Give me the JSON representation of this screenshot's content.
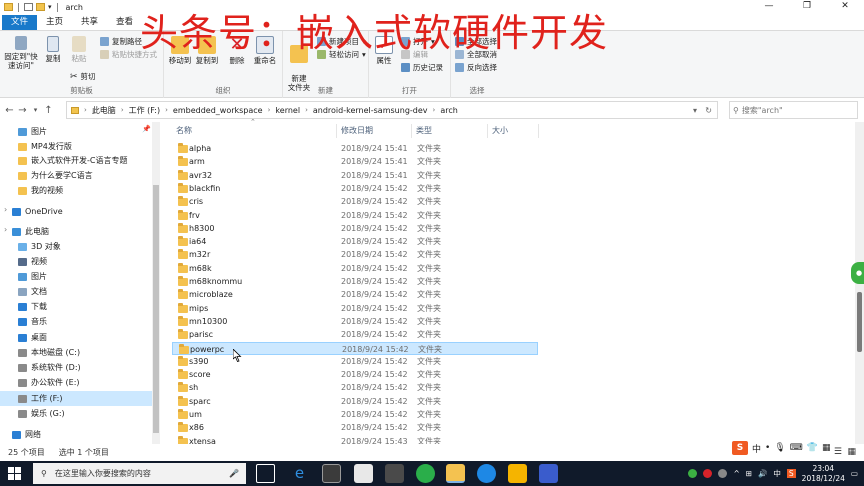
{
  "window": {
    "title": "arch",
    "min_glyph": "—",
    "max_glyph": "❐",
    "close_glyph": "✕"
  },
  "ribbon_tabs": [
    "文件",
    "主页",
    "共享",
    "查看"
  ],
  "watermark": "头条号：嵌入式软硬件开发",
  "ribbon": {
    "clipboard": {
      "label": "剪贴板",
      "pin": "固定到\"快速访问\"",
      "copy": "复制",
      "paste": "粘贴",
      "copy_path": "复制路径",
      "paste_shortcut": "粘贴快捷方式",
      "cut": "剪切"
    },
    "organize": {
      "label": "组织",
      "move_to": "移动到",
      "copy_to": "复制到",
      "delete": "删除",
      "rename": "重命名"
    },
    "new": {
      "label": "新建",
      "new_folder": "新建\n文件夹",
      "new_item": "新建项目",
      "easy_access": "轻松访问"
    },
    "open": {
      "label": "打开",
      "properties": "属性",
      "open": "打开",
      "edit": "编辑",
      "history": "历史记录"
    },
    "select": {
      "label": "选择",
      "select_all": "全部选择",
      "select_none": "全部取消",
      "invert": "反向选择"
    }
  },
  "address": {
    "crumbs": [
      "此电脑",
      "工作 (F:)",
      "embedded_workspace",
      "kernel",
      "android-kernel-samsung-dev",
      "arch"
    ],
    "search_placeholder": "搜索\"arch\""
  },
  "nav_pane": {
    "items": [
      {
        "label": "图片",
        "icon": "pictures-icon",
        "color": "#4f9ad8"
      },
      {
        "label": "MP4发行版",
        "icon": "folder-icon",
        "color": "#f4c250"
      },
      {
        "label": "嵌入式软件开发-C语言专题",
        "icon": "folder-icon",
        "color": "#f4c250"
      },
      {
        "label": "为什么要学C语言",
        "icon": "folder-icon",
        "color": "#f4c250"
      },
      {
        "label": "我的视频",
        "icon": "folder-icon",
        "color": "#f4c250"
      },
      {
        "label": "OneDrive",
        "icon": "cloud-icon",
        "color": "#2a7fd4"
      },
      {
        "label": "此电脑",
        "icon": "computer-icon",
        "color": "#3a8fd8"
      },
      {
        "label": "3D 对象",
        "icon": "cube-icon",
        "color": "#6ab0e8"
      },
      {
        "label": "视频",
        "icon": "video-icon",
        "color": "#556b8a"
      },
      {
        "label": "图片",
        "icon": "pictures-icon",
        "color": "#4f9ad8"
      },
      {
        "label": "文档",
        "icon": "document-icon",
        "color": "#8aa4c0"
      },
      {
        "label": "下载",
        "icon": "download-icon",
        "color": "#2a7fd4"
      },
      {
        "label": "音乐",
        "icon": "music-icon",
        "color": "#2a7fd4"
      },
      {
        "label": "桌面",
        "icon": "desktop-icon",
        "color": "#2a7fd4"
      },
      {
        "label": "本地磁盘 (C:)",
        "icon": "drive-icon",
        "color": "#8a8a8a"
      },
      {
        "label": "系统软件 (D:)",
        "icon": "drive-icon",
        "color": "#8a8a8a"
      },
      {
        "label": "办公软件 (E:)",
        "icon": "drive-icon",
        "color": "#8a8a8a"
      },
      {
        "label": "工作 (F:)",
        "icon": "drive-icon",
        "color": "#8a8a8a"
      },
      {
        "label": "娱乐 (G:)",
        "icon": "drive-icon",
        "color": "#8a8a8a"
      },
      {
        "label": "网络",
        "icon": "network-icon",
        "color": "#2a7fd4"
      }
    ]
  },
  "columns": {
    "name": "名称",
    "modified": "修改日期",
    "type": "类型",
    "size": "大小"
  },
  "files": [
    {
      "name": "alpha",
      "date": "2018/9/24 15:41",
      "type": "文件夹"
    },
    {
      "name": "arm",
      "date": "2018/9/24 15:41",
      "type": "文件夹"
    },
    {
      "name": "avr32",
      "date": "2018/9/24 15:41",
      "type": "文件夹"
    },
    {
      "name": "blackfin",
      "date": "2018/9/24 15:42",
      "type": "文件夹"
    },
    {
      "name": "cris",
      "date": "2018/9/24 15:42",
      "type": "文件夹"
    },
    {
      "name": "frv",
      "date": "2018/9/24 15:42",
      "type": "文件夹"
    },
    {
      "name": "h8300",
      "date": "2018/9/24 15:42",
      "type": "文件夹"
    },
    {
      "name": "ia64",
      "date": "2018/9/24 15:42",
      "type": "文件夹"
    },
    {
      "name": "m32r",
      "date": "2018/9/24 15:42",
      "type": "文件夹"
    },
    {
      "name": "m68k",
      "date": "2018/9/24 15:42",
      "type": "文件夹"
    },
    {
      "name": "m68knommu",
      "date": "2018/9/24 15:42",
      "type": "文件夹"
    },
    {
      "name": "microblaze",
      "date": "2018/9/24 15:42",
      "type": "文件夹"
    },
    {
      "name": "mips",
      "date": "2018/9/24 15:42",
      "type": "文件夹"
    },
    {
      "name": "mn10300",
      "date": "2018/9/24 15:42",
      "type": "文件夹"
    },
    {
      "name": "parisc",
      "date": "2018/9/24 15:42",
      "type": "文件夹"
    },
    {
      "name": "powerpc",
      "date": "2018/9/24 15:42",
      "type": "文件夹"
    },
    {
      "name": "s390",
      "date": "2018/9/24 15:42",
      "type": "文件夹"
    },
    {
      "name": "score",
      "date": "2018/9/24 15:42",
      "type": "文件夹"
    },
    {
      "name": "sh",
      "date": "2018/9/24 15:42",
      "type": "文件夹"
    },
    {
      "name": "sparc",
      "date": "2018/9/24 15:42",
      "type": "文件夹"
    },
    {
      "name": "um",
      "date": "2018/9/24 15:42",
      "type": "文件夹"
    },
    {
      "name": "x86",
      "date": "2018/9/24 15:42",
      "type": "文件夹"
    },
    {
      "name": "xtensa",
      "date": "2018/9/24 15:43",
      "type": "文件夹"
    }
  ],
  "selected_file": "powerpc",
  "status": {
    "count": "25 个项目",
    "selected": "选中 1 个项目"
  },
  "ime": {
    "sogou": "S",
    "lang": "中"
  },
  "taskbar": {
    "search_placeholder": "在这里输入你要搜索的内容",
    "time": "23:04",
    "date": "2018/12/24",
    "tray_lang": "中"
  },
  "colors": {
    "accent": "#1979ca",
    "selection": "#cce8ff",
    "watermark": "#e0221c",
    "folder": "#f4c250"
  }
}
